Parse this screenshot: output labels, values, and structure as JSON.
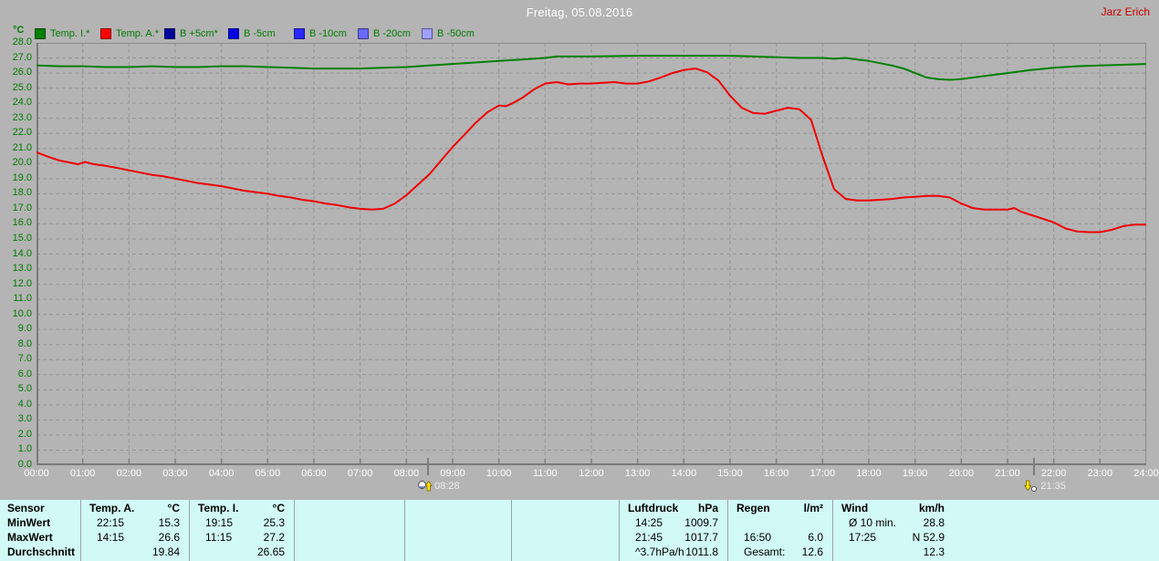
{
  "header": {
    "title": "Freitag, 05.08.2016",
    "user": "Jarz Erich"
  },
  "legend": {
    "unit": "°C",
    "items": [
      {
        "label": "Temp. I.*",
        "color": "#008000"
      },
      {
        "label": "Temp. A.*",
        "color": "#ff0000"
      },
      {
        "label": "B +5cm*",
        "color": "#0000a0"
      },
      {
        "label": "B -5cm",
        "color": "#0000e8"
      },
      {
        "label": "B -10cm",
        "color": "#2828ff"
      },
      {
        "label": "B -20cm",
        "color": "#6868ff"
      },
      {
        "label": "B -50cm",
        "color": "#9f9fff"
      }
    ]
  },
  "chart_data": {
    "type": "line",
    "title": "Freitag, 05.08.2016",
    "grid": true,
    "x_axis": {
      "min": 0,
      "max": 24,
      "tick_hours": 1,
      "tick_labels": [
        "00:00",
        "01:00",
        "02:00",
        "03:00",
        "04:00",
        "05:00",
        "06:00",
        "07:00",
        "08:00",
        "09:00",
        "10:00",
        "11:00",
        "12:00",
        "13:00",
        "14:00",
        "15:00",
        "16:00",
        "17:00",
        "18:00",
        "19:00",
        "20:00",
        "21:00",
        "22:00",
        "23:00",
        "24:00"
      ]
    },
    "y_axis": {
      "min": 0,
      "max": 28,
      "tick": 1,
      "unit": "°C",
      "tick_labels": [
        "0.0",
        "1.0",
        "2.0",
        "3.0",
        "4.0",
        "5.0",
        "6.0",
        "7.0",
        "8.0",
        "9.0",
        "10.0",
        "11.0",
        "12.0",
        "13.0",
        "14.0",
        "15.0",
        "16.0",
        "17.0",
        "18.0",
        "19.0",
        "20.0",
        "21.0",
        "22.0",
        "23.0",
        "24.0",
        "25.0",
        "26.0",
        "27.0",
        "28.0"
      ]
    },
    "sun_markers": [
      {
        "type": "sunrise",
        "label": "08:28",
        "hour": 8.47
      },
      {
        "type": "sunset",
        "label": "21:35",
        "hour": 21.58
      }
    ],
    "series": [
      {
        "name": "Temp. I.*",
        "color": "#008000",
        "points": [
          [
            0,
            26.5
          ],
          [
            0.5,
            26.45
          ],
          [
            1,
            26.45
          ],
          [
            1.5,
            26.4
          ],
          [
            2,
            26.4
          ],
          [
            2.5,
            26.45
          ],
          [
            3,
            26.4
          ],
          [
            3.5,
            26.4
          ],
          [
            4,
            26.45
          ],
          [
            4.5,
            26.45
          ],
          [
            5,
            26.4
          ],
          [
            5.5,
            26.35
          ],
          [
            6,
            26.3
          ],
          [
            6.5,
            26.3
          ],
          [
            7,
            26.3
          ],
          [
            7.5,
            26.35
          ],
          [
            8,
            26.4
          ],
          [
            8.5,
            26.5
          ],
          [
            9,
            26.6
          ],
          [
            9.5,
            26.7
          ],
          [
            10,
            26.8
          ],
          [
            10.5,
            26.9
          ],
          [
            11,
            27.0
          ],
          [
            11.25,
            27.1
          ],
          [
            12,
            27.1
          ],
          [
            13,
            27.15
          ],
          [
            14,
            27.15
          ],
          [
            15,
            27.15
          ],
          [
            15.5,
            27.1
          ],
          [
            16,
            27.05
          ],
          [
            16.5,
            27.0
          ],
          [
            17,
            27.0
          ],
          [
            17.25,
            26.95
          ],
          [
            17.5,
            27.0
          ],
          [
            17.75,
            26.9
          ],
          [
            18,
            26.8
          ],
          [
            18.25,
            26.65
          ],
          [
            18.5,
            26.5
          ],
          [
            18.75,
            26.3
          ],
          [
            19,
            26.0
          ],
          [
            19.25,
            25.7
          ],
          [
            19.5,
            25.6
          ],
          [
            19.75,
            25.55
          ],
          [
            20,
            25.6
          ],
          [
            20.25,
            25.7
          ],
          [
            20.5,
            25.8
          ],
          [
            21,
            26.0
          ],
          [
            21.5,
            26.2
          ],
          [
            22,
            26.35
          ],
          [
            22.5,
            26.45
          ],
          [
            23,
            26.5
          ],
          [
            23.5,
            26.55
          ],
          [
            24,
            26.6
          ]
        ]
      },
      {
        "name": "Temp. A.*",
        "color": "#ee0000",
        "points": [
          [
            0,
            20.75
          ],
          [
            0.25,
            20.45
          ],
          [
            0.5,
            20.2
          ],
          [
            0.75,
            20.05
          ],
          [
            0.9,
            19.95
          ],
          [
            1.05,
            20.1
          ],
          [
            1.25,
            19.95
          ],
          [
            1.5,
            19.85
          ],
          [
            1.75,
            19.7
          ],
          [
            2,
            19.55
          ],
          [
            2.25,
            19.4
          ],
          [
            2.5,
            19.25
          ],
          [
            2.75,
            19.15
          ],
          [
            3,
            19.0
          ],
          [
            3.25,
            18.85
          ],
          [
            3.5,
            18.7
          ],
          [
            3.75,
            18.6
          ],
          [
            4,
            18.5
          ],
          [
            4.25,
            18.35
          ],
          [
            4.5,
            18.2
          ],
          [
            4.75,
            18.1
          ],
          [
            5,
            18.0
          ],
          [
            5.25,
            17.85
          ],
          [
            5.5,
            17.75
          ],
          [
            5.75,
            17.6
          ],
          [
            6,
            17.5
          ],
          [
            6.25,
            17.35
          ],
          [
            6.5,
            17.25
          ],
          [
            6.75,
            17.1
          ],
          [
            7,
            17.0
          ],
          [
            7.25,
            16.95
          ],
          [
            7.5,
            17.0
          ],
          [
            7.75,
            17.35
          ],
          [
            8,
            17.9
          ],
          [
            8.25,
            18.6
          ],
          [
            8.5,
            19.3
          ],
          [
            8.75,
            20.2
          ],
          [
            9,
            21.1
          ],
          [
            9.25,
            21.9
          ],
          [
            9.5,
            22.7
          ],
          [
            9.75,
            23.4
          ],
          [
            10,
            23.85
          ],
          [
            10.15,
            23.8
          ],
          [
            10.3,
            24.0
          ],
          [
            10.5,
            24.35
          ],
          [
            10.75,
            24.9
          ],
          [
            11,
            25.3
          ],
          [
            11.25,
            25.4
          ],
          [
            11.5,
            25.25
          ],
          [
            11.75,
            25.3
          ],
          [
            12,
            25.3
          ],
          [
            12.25,
            25.35
          ],
          [
            12.5,
            25.4
          ],
          [
            12.75,
            25.3
          ],
          [
            13,
            25.3
          ],
          [
            13.25,
            25.45
          ],
          [
            13.5,
            25.7
          ],
          [
            13.75,
            26.0
          ],
          [
            14,
            26.2
          ],
          [
            14.25,
            26.3
          ],
          [
            14.5,
            26.05
          ],
          [
            14.75,
            25.5
          ],
          [
            15,
            24.5
          ],
          [
            15.25,
            23.7
          ],
          [
            15.5,
            23.35
          ],
          [
            15.75,
            23.3
          ],
          [
            16,
            23.5
          ],
          [
            16.25,
            23.7
          ],
          [
            16.5,
            23.6
          ],
          [
            16.75,
            22.9
          ],
          [
            17,
            20.5
          ],
          [
            17.25,
            18.3
          ],
          [
            17.5,
            17.65
          ],
          [
            17.75,
            17.55
          ],
          [
            18,
            17.55
          ],
          [
            18.25,
            17.6
          ],
          [
            18.5,
            17.65
          ],
          [
            18.75,
            17.75
          ],
          [
            19,
            17.8
          ],
          [
            19.25,
            17.85
          ],
          [
            19.5,
            17.85
          ],
          [
            19.75,
            17.75
          ],
          [
            20,
            17.35
          ],
          [
            20.25,
            17.05
          ],
          [
            20.5,
            16.95
          ],
          [
            20.75,
            16.95
          ],
          [
            21,
            16.95
          ],
          [
            21.15,
            17.05
          ],
          [
            21.3,
            16.8
          ],
          [
            21.5,
            16.6
          ],
          [
            21.75,
            16.35
          ],
          [
            22,
            16.1
          ],
          [
            22.25,
            15.7
          ],
          [
            22.5,
            15.5
          ],
          [
            22.75,
            15.45
          ],
          [
            23,
            15.45
          ],
          [
            23.25,
            15.6
          ],
          [
            23.5,
            15.85
          ],
          [
            23.75,
            15.95
          ],
          [
            24,
            15.95
          ]
        ]
      }
    ]
  },
  "stats_table": {
    "row_labels": [
      "Sensor",
      "MinWert",
      "MaxWert",
      "Durchschnitt"
    ],
    "columns": [
      {
        "name": "Temp. A.",
        "unit": "°C",
        "rows": [
          [
            "22:15",
            "15.3"
          ],
          [
            "14:15",
            "26.6"
          ],
          [
            "",
            "19.84"
          ]
        ]
      },
      {
        "name": "Temp. I.",
        "unit": "°C",
        "rows": [
          [
            "19:15",
            "25.3"
          ],
          [
            "11:15",
            "27.2"
          ],
          [
            "",
            "26.65"
          ]
        ]
      },
      {
        "name": "",
        "unit": "",
        "rows": [
          [
            "",
            ""
          ],
          [
            "",
            ""
          ],
          [
            "",
            ""
          ]
        ]
      },
      {
        "name": "",
        "unit": "",
        "rows": [
          [
            "",
            ""
          ],
          [
            "",
            ""
          ],
          [
            "",
            ""
          ]
        ]
      },
      {
        "name": "",
        "unit": "",
        "rows": [
          [
            "",
            ""
          ],
          [
            "",
            ""
          ],
          [
            "",
            ""
          ]
        ]
      },
      {
        "name": "Luftdruck",
        "unit": "hPa",
        "rows": [
          [
            "14:25",
            "1009.7"
          ],
          [
            "21:45",
            "1017.7"
          ],
          [
            "^3.7hPa/h",
            "1011.8"
          ]
        ]
      },
      {
        "name": "Regen",
        "unit": "l/m²",
        "rows": [
          [
            "",
            ""
          ],
          [
            "16:50",
            "6.0"
          ],
          [
            "Gesamt:",
            "12.6"
          ]
        ]
      },
      {
        "name": "Wind",
        "unit": "km/h",
        "rows": [
          [
            "Ø 10 min.",
            "28.8"
          ],
          [
            "17:25",
            "N 52.9"
          ],
          [
            "",
            "12.3"
          ]
        ]
      }
    ]
  }
}
